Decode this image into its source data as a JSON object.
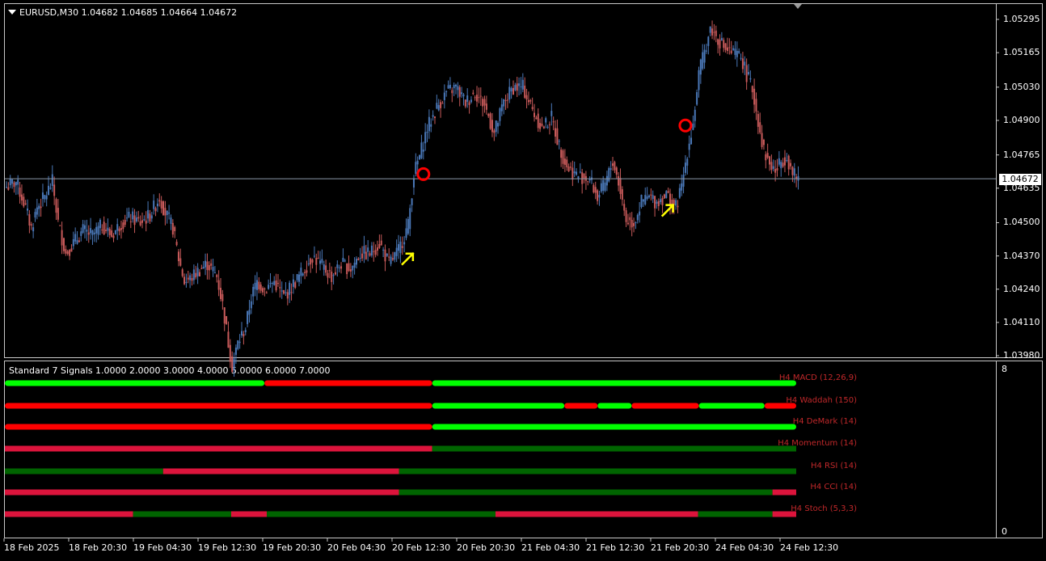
{
  "chart_header": {
    "symbol_title": "EURUSD,M30  1.04682 1.04685 1.04664 1.04672"
  },
  "indicator_header": {
    "title": "Standard 7 Signals 1.0000 2.0000 3.0000 4.0000 5.0000 6.0000 7.0000",
    "scale_top": "8",
    "scale_bottom": "0"
  },
  "colors": {
    "bull_candle": "#4a78b8",
    "bear_candle": "#c85a5a",
    "signal_green": "#00ff00",
    "signal_red": "#ff0000",
    "bar_green": "#006400",
    "bar_red": "#dc143c",
    "arrow": "#ffff00",
    "circle": "#ff0000",
    "label_red": "#c0282a"
  },
  "current_price": "1.04672",
  "chart_data": {
    "type": "candlestick",
    "ylim": [
      1.0398,
      1.0534
    ],
    "price_ticks": [
      "1.05295",
      "1.05165",
      "1.05030",
      "1.04900",
      "1.04765",
      "1.04635",
      "1.04500",
      "1.04370",
      "1.04240",
      "1.04110",
      "1.03980"
    ],
    "time_ticks": [
      "18 Feb 2025",
      "18 Feb 20:30",
      "19 Feb 04:30",
      "19 Feb 12:30",
      "19 Feb 20:30",
      "20 Feb 04:30",
      "20 Feb 12:30",
      "20 Feb 20:30",
      "21 Feb 04:30",
      "21 Feb 12:30",
      "21 Feb 20:30",
      "24 Feb 04:30",
      "24 Feb 12:30"
    ],
    "close_path": [
      [
        0,
        1.0464
      ],
      [
        5,
        1.0466
      ],
      [
        9,
        1.0458
      ],
      [
        13,
        1.0448
      ],
      [
        16,
        1.0456
      ],
      [
        20,
        1.046
      ],
      [
        24,
        1.0466
      ],
      [
        27,
        1.045
      ],
      [
        31,
        1.0438
      ],
      [
        35,
        1.0442
      ],
      [
        40,
        1.0447
      ],
      [
        45,
        1.0445
      ],
      [
        50,
        1.0449
      ],
      [
        55,
        1.0445
      ],
      [
        60,
        1.045
      ],
      [
        65,
        1.0452
      ],
      [
        70,
        1.045
      ],
      [
        75,
        1.0453
      ],
      [
        80,
        1.046
      ],
      [
        83,
        1.0454
      ],
      [
        87,
        1.0448
      ],
      [
        90,
        1.0436
      ],
      [
        93,
        1.0427
      ],
      [
        96,
        1.0428
      ],
      [
        100,
        1.0431
      ],
      [
        105,
        1.0434
      ],
      [
        110,
        1.0429
      ],
      [
        113,
        1.0418
      ],
      [
        116,
        1.0403
      ],
      [
        118,
        1.0394
      ],
      [
        121,
        1.0403
      ],
      [
        125,
        1.0409
      ],
      [
        128,
        1.0421
      ],
      [
        131,
        1.0427
      ],
      [
        135,
        1.0424
      ],
      [
        140,
        1.0427
      ],
      [
        145,
        1.0421
      ],
      [
        150,
        1.0426
      ],
      [
        155,
        1.0431
      ],
      [
        160,
        1.0437
      ],
      [
        165,
        1.0433
      ],
      [
        170,
        1.0429
      ],
      [
        175,
        1.0434
      ],
      [
        180,
        1.0432
      ],
      [
        185,
        1.0438
      ],
      [
        190,
        1.0438
      ],
      [
        195,
        1.0442
      ],
      [
        200,
        1.0434
      ],
      [
        205,
        1.0439
      ],
      [
        210,
        1.0449
      ],
      [
        213,
        1.0469
      ],
      [
        216,
        1.0476
      ],
      [
        220,
        1.0487
      ],
      [
        225,
        1.0495
      ],
      [
        230,
        1.0501
      ],
      [
        235,
        1.0503
      ],
      [
        240,
        1.0497
      ],
      [
        245,
        1.0501
      ],
      [
        250,
        1.0496
      ],
      [
        255,
        1.0485
      ],
      [
        260,
        1.0497
      ],
      [
        265,
        1.0503
      ],
      [
        270,
        1.0503
      ],
      [
        275,
        1.0494
      ],
      [
        280,
        1.0487
      ],
      [
        285,
        1.0491
      ],
      [
        289,
        1.048
      ],
      [
        293,
        1.0472
      ],
      [
        297,
        1.0469
      ],
      [
        301,
        1.0468
      ],
      [
        305,
        1.0467
      ],
      [
        309,
        1.046
      ],
      [
        313,
        1.0465
      ],
      [
        317,
        1.0474
      ],
      [
        320,
        1.0466
      ],
      [
        324,
        1.0451
      ],
      [
        328,
        1.045
      ],
      [
        332,
        1.0458
      ],
      [
        336,
        1.046
      ],
      [
        340,
        1.0458
      ],
      [
        345,
        1.0461
      ],
      [
        350,
        1.0456
      ],
      [
        353,
        1.0464
      ],
      [
        356,
        1.0478
      ],
      [
        359,
        1.0489
      ],
      [
        362,
        1.0508
      ],
      [
        365,
        1.0517
      ],
      [
        368,
        1.0526
      ],
      [
        372,
        1.0522
      ],
      [
        376,
        1.0518
      ],
      [
        380,
        1.0516
      ],
      [
        384,
        1.0515
      ],
      [
        387,
        1.0508
      ],
      [
        390,
        1.0502
      ],
      [
        393,
        1.049
      ],
      [
        396,
        1.0478
      ],
      [
        399,
        1.0473
      ],
      [
        402,
        1.047
      ],
      [
        405,
        1.0474
      ],
      [
        408,
        1.0476
      ],
      [
        411,
        1.0469
      ],
      [
        414,
        1.0467
      ]
    ],
    "signals": [
      {
        "kind": "arrow",
        "bar": 210,
        "price": 1.0436
      },
      {
        "kind": "arrow",
        "bar": 346,
        "price": 1.0455
      },
      {
        "kind": "circle",
        "bar": 218,
        "price": 1.0469
      },
      {
        "kind": "circle",
        "bar": 355,
        "price": 1.0488
      }
    ]
  },
  "indicator_rows": [
    {
      "label": "H4 MACD (12,26,9)",
      "style": "dots",
      "segments": [
        [
          "green",
          0,
          0.328
        ],
        [
          "red",
          0.328,
          0.54
        ],
        [
          "green",
          0.54,
          1
        ]
      ]
    },
    {
      "label": "H4 Waddah (150)",
      "style": "dots",
      "segments": [
        [
          "red",
          0,
          0.54
        ],
        [
          "green",
          0.54,
          0.707
        ],
        [
          "red",
          0.707,
          0.749
        ],
        [
          "green",
          0.749,
          0.792
        ],
        [
          "red",
          0.792,
          0.877
        ],
        [
          "green",
          0.877,
          0.96
        ],
        [
          "red",
          0.96,
          1
        ]
      ]
    },
    {
      "label": "H4 DeMark (14)",
      "style": "dots",
      "segments": [
        [
          "red",
          0,
          0.54
        ],
        [
          "green",
          0.54,
          1
        ]
      ]
    },
    {
      "label": "H4 Momentum (14)",
      "style": "bar",
      "segments": [
        [
          "red",
          0,
          0.54
        ],
        [
          "green",
          0.54,
          1
        ]
      ]
    },
    {
      "label": "H4 RSI (14)",
      "style": "bar",
      "segments": [
        [
          "green",
          0,
          0.2
        ],
        [
          "red",
          0.2,
          0.498
        ],
        [
          "green",
          0.498,
          1
        ]
      ]
    },
    {
      "label": "H4 CCI (14)",
      "style": "bar",
      "segments": [
        [
          "red",
          0,
          0.498
        ],
        [
          "green",
          0.498,
          0.97
        ],
        [
          "red",
          0.97,
          1
        ]
      ]
    },
    {
      "label": "H4 Stoch (5,3,3)",
      "style": "bar",
      "segments": [
        [
          "red",
          0,
          0.162
        ],
        [
          "green",
          0.162,
          0.286
        ],
        [
          "red",
          0.286,
          0.331
        ],
        [
          "green",
          0.331,
          0.62
        ],
        [
          "red",
          0.62,
          0.876
        ],
        [
          "green",
          0.876,
          0.97
        ],
        [
          "red",
          0.97,
          1
        ]
      ]
    }
  ]
}
